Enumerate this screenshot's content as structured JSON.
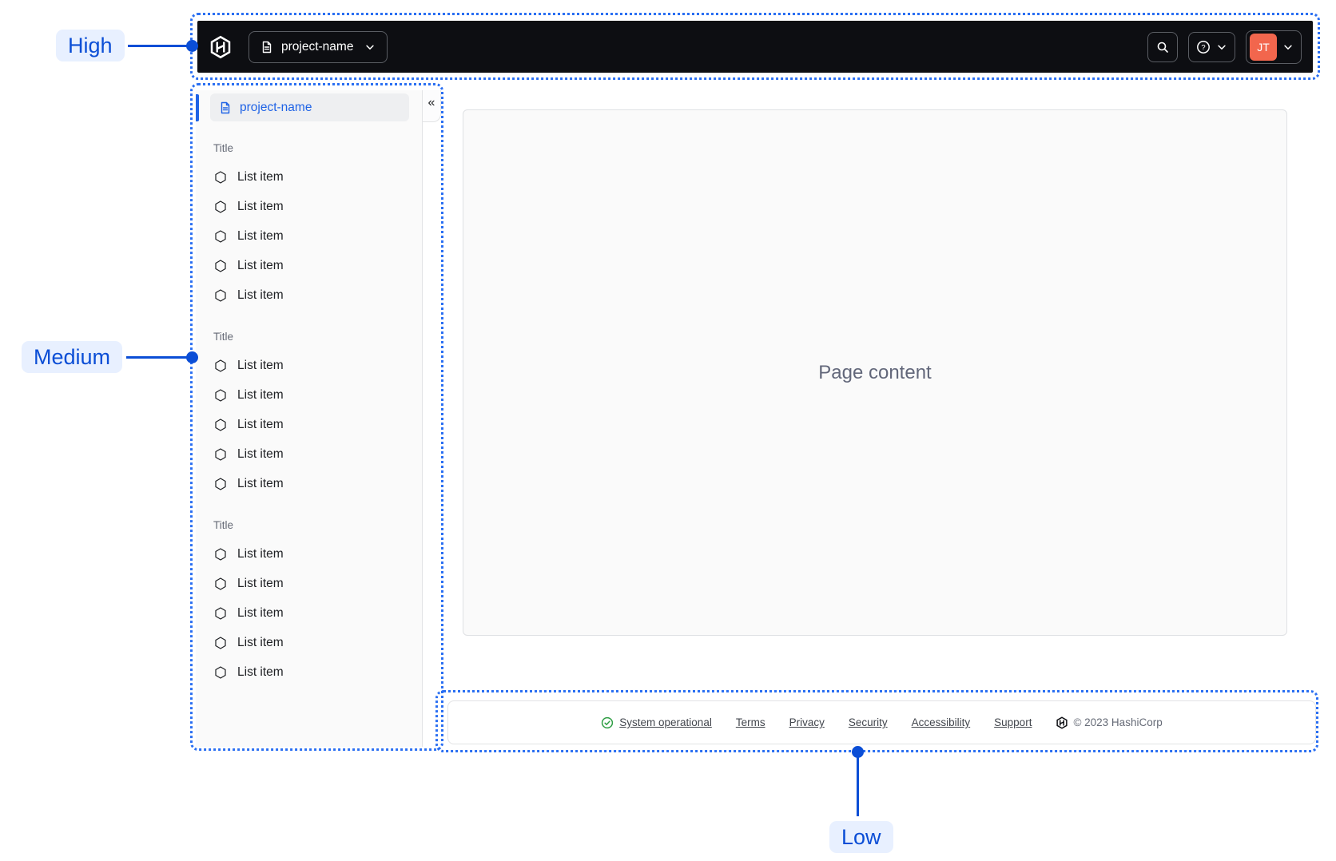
{
  "annotations": {
    "high": "High",
    "medium": "Medium",
    "low": "Low"
  },
  "topnav": {
    "project_selector_label": "project-name",
    "user_initials": "JT"
  },
  "sidebar": {
    "selected_item_label": "project-name",
    "collapse_glyph": "«",
    "sections": [
      {
        "title": "Title",
        "items": [
          "List item",
          "List item",
          "List item",
          "List item",
          "List item"
        ]
      },
      {
        "title": "Title",
        "items": [
          "List item",
          "List item",
          "List item",
          "List item",
          "List item"
        ]
      },
      {
        "title": "Title",
        "items": [
          "List item",
          "List item",
          "List item",
          "List item",
          "List item"
        ]
      }
    ]
  },
  "main": {
    "placeholder": "Page content"
  },
  "footer": {
    "status_label": "System operational",
    "links": [
      "Terms",
      "Privacy",
      "Security",
      "Accessibility",
      "Support"
    ],
    "copyright": "© 2023 HashiCorp"
  },
  "icons": {
    "help_glyph": "?"
  },
  "colors": {
    "annotation_blue": "#0B4ED6",
    "annotation_dotted_blue": "#2A6FF2",
    "annotation_label_bg": "#E8F0FF",
    "navbar_bg": "#0D0E12",
    "link_blue": "#1F63E6",
    "avatar_bg": "#F2664D",
    "status_green": "#2F9E44"
  }
}
